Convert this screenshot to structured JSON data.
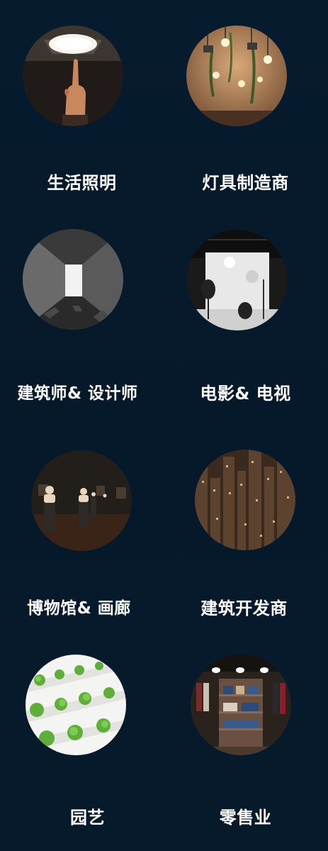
{
  "categories": [
    {
      "label": "生活照明",
      "image": "hand-under-ceiling-light"
    },
    {
      "label": "灯具制造商",
      "image": "hanging-pendant-lamps"
    },
    {
      "label": "建筑师& 设计师",
      "image": "corridor-with-light"
    },
    {
      "label": "电影& 电视",
      "image": "film-studio-lighting"
    },
    {
      "label": "博物馆& 画廊",
      "image": "museum-sculptures"
    },
    {
      "label": "建筑开发商",
      "image": "city-skyline-night"
    },
    {
      "label": "园艺",
      "image": "hydroponic-lettuce"
    },
    {
      "label": "零售业",
      "image": "clothing-store-shelves"
    }
  ],
  "colors": {
    "background": "#061a2c",
    "label_text": "#ffffff"
  }
}
